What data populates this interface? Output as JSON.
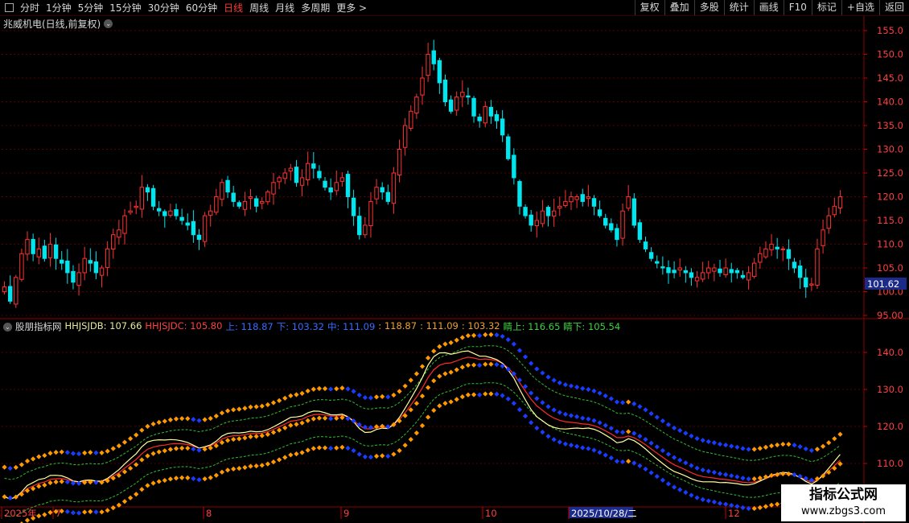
{
  "toolbar": {
    "timeframes": [
      "分时",
      "1分钟",
      "5分钟",
      "15分钟",
      "30分钟",
      "60分钟",
      "日线",
      "周线",
      "月线",
      "多周期",
      "更多 >"
    ],
    "active_timeframe": "日线",
    "right_buttons": [
      "复权",
      "叠加",
      "多股",
      "统计",
      "画线",
      "F10",
      "标记",
      "+自选",
      "返回"
    ]
  },
  "stock_title": "兆威机电(日线,前复权)",
  "indicator": {
    "name": "股朋指标网",
    "items": [
      {
        "text": "HHJSJDB: 107.66",
        "color": "#e8e8a0"
      },
      {
        "text": "HHJSJDC: 105.80",
        "color": "#ff4040"
      },
      {
        "text": "上: 118.87",
        "color": "#3a6bff"
      },
      {
        "text": "下: 103.32",
        "color": "#3a6bff"
      },
      {
        "text": "中: 111.09",
        "color": "#3a6bff"
      },
      {
        "text": ": 118.87",
        "color": "#f0a030"
      },
      {
        "text": ": 111.09",
        "color": "#f0a030"
      },
      {
        "text": ": 103.32",
        "color": "#f0a030"
      },
      {
        "text": "睛上: 116.65",
        "color": "#40d040"
      },
      {
        "text": "睛下: 105.54",
        "color": "#40d040"
      }
    ]
  },
  "price_axis": {
    "ticks": [
      "155.0",
      "150.0",
      "145.0",
      "140.0",
      "135.0",
      "130.0",
      "125.0",
      "120.0",
      "115.0",
      "110.0",
      "105.0",
      "100.0",
      "95.00"
    ],
    "current_price": "101.62"
  },
  "indicator_axis": {
    "ticks": [
      "140.0",
      "130.0",
      "120.0",
      "110.0"
    ]
  },
  "date_axis": {
    "labels": [
      "2025年",
      "7",
      "8",
      "9",
      "10",
      "2025/10/28/二",
      "12"
    ]
  },
  "watermark": {
    "line1": "指标公式网",
    "line2": "www.zbgs3.com"
  },
  "colors": {
    "up": "#ff3232",
    "down": "#00e5ee",
    "orange": "#ff9900",
    "blue": "#1a3cff",
    "green": "#30c030",
    "yellow": "#ffffa0",
    "grid": "#5a0000"
  },
  "chart_data": {
    "type": "candlestick",
    "closes": [
      101,
      98,
      103,
      108,
      111,
      108,
      109,
      107,
      110,
      107,
      106,
      104,
      102,
      104,
      107,
      106,
      104,
      105,
      109,
      112,
      113,
      116,
      117,
      118,
      122,
      121,
      118,
      117,
      116,
      117,
      116,
      115,
      114,
      112,
      111,
      116,
      117,
      120,
      123,
      121,
      119,
      118,
      119,
      120,
      118,
      119,
      121,
      123,
      124,
      125,
      126,
      123,
      124,
      127,
      126,
      124,
      122,
      121,
      123,
      124,
      120,
      116,
      112,
      114,
      119,
      122,
      121,
      119,
      125,
      130,
      135,
      138,
      141,
      145,
      150,
      148,
      144,
      140,
      138,
      141,
      142,
      141,
      137,
      136,
      139,
      137,
      136,
      133,
      128,
      124,
      118,
      116,
      114,
      115,
      117,
      116,
      117,
      118,
      119,
      120,
      120,
      119,
      120,
      118,
      116,
      114,
      113,
      111,
      117,
      120,
      114,
      111,
      109,
      107,
      106,
      105,
      104,
      104,
      105,
      104,
      103,
      103,
      104,
      105,
      105,
      104,
      105,
      104,
      104,
      103,
      104,
      106,
      108,
      109,
      110,
      109,
      109,
      107,
      105,
      103,
      101,
      101.62,
      109,
      113,
      116,
      118,
      120
    ],
    "price_range": [
      95,
      155
    ],
    "indicator_range": [
      100,
      145
    ],
    "indicator_series": [
      "HHJSJDB",
      "HHJSJDC",
      "上",
      "中",
      "下",
      "睛上",
      "睛下"
    ]
  }
}
